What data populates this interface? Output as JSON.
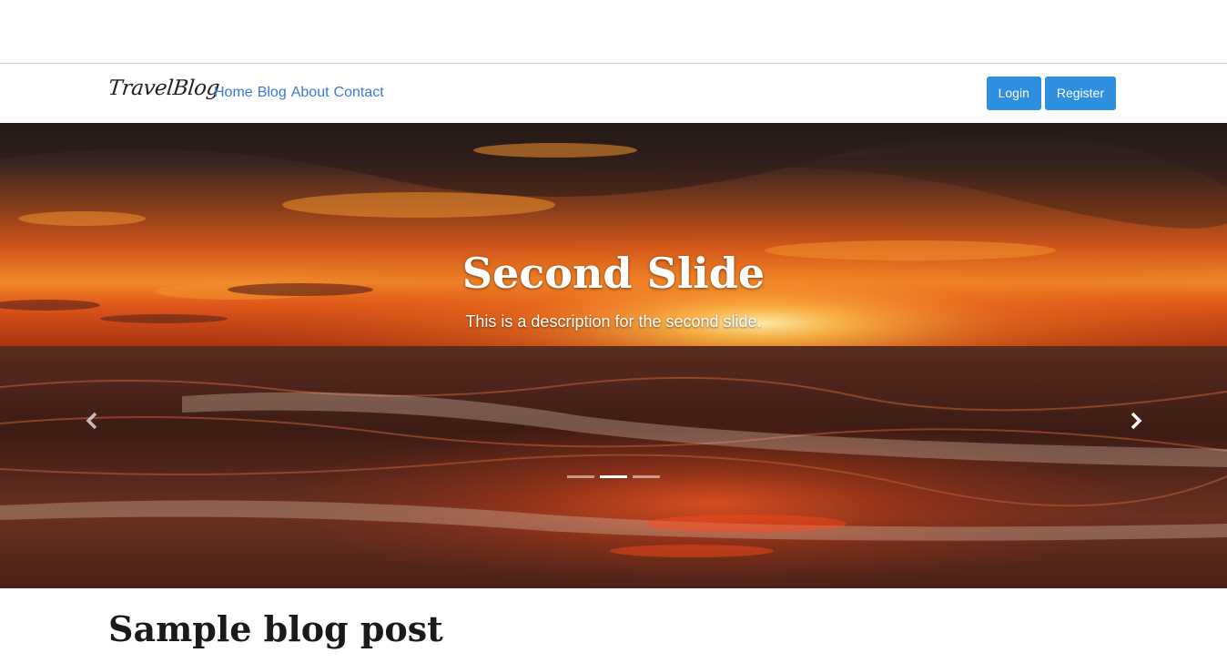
{
  "navbar": {
    "brand": "TravelBlog",
    "links": [
      "Home",
      "Blog",
      "About",
      "Contact"
    ],
    "login_label": "Login",
    "register_label": "Register"
  },
  "carousel": {
    "title": "Second Slide",
    "description": "This is a description for the second slide.",
    "prev_icon": "chevron-left-icon",
    "next_icon": "chevron-right-icon",
    "slide_count": 3,
    "active_index": 1
  },
  "post": {
    "title": "Sample blog post"
  },
  "colors": {
    "link": "#3a7bd5",
    "button": "#2f8fdf"
  }
}
